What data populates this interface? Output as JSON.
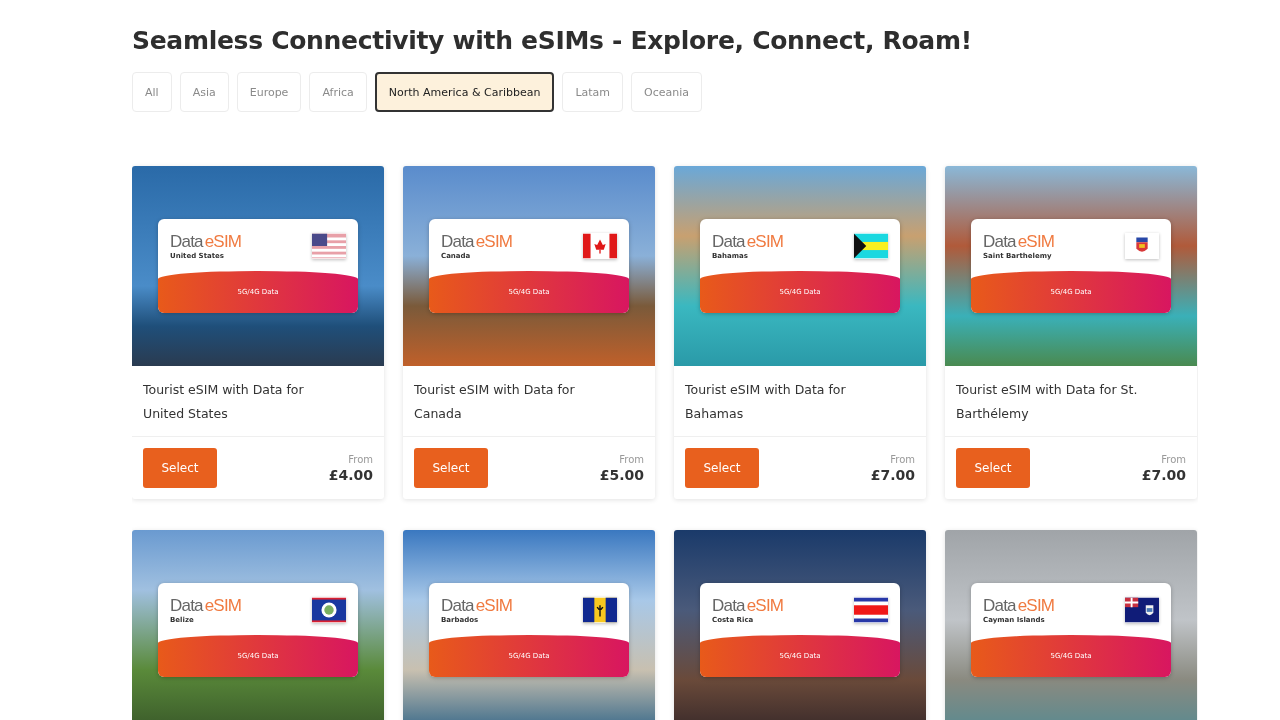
{
  "heading": "Seamless Connectivity with eSIMs - Explore, Connect, Roam!",
  "tabs": [
    {
      "label": "All",
      "selected": false
    },
    {
      "label": "Asia",
      "selected": false
    },
    {
      "label": "Europe",
      "selected": false
    },
    {
      "label": "Africa",
      "selected": false
    },
    {
      "label": "North America & Caribbean",
      "selected": true
    },
    {
      "label": "Latam",
      "selected": false
    },
    {
      "label": "Oceania",
      "selected": false
    }
  ],
  "cards": [
    {
      "brand": "Data",
      "brand_accent": "eSIM",
      "country": "United States",
      "kind": "us",
      "data_label": "5G/4G Data",
      "title": "Tourist eSIM with Data for United States",
      "button": "Select",
      "price_prefix": "From",
      "price": "£4.00"
    },
    {
      "brand": "Data",
      "brand_accent": "eSIM",
      "country": "Canada",
      "kind": "ca",
      "data_label": "5G/4G Data",
      "title": "Tourist eSIM with Data for Canada",
      "button": "Select",
      "price_prefix": "From",
      "price": "£5.00"
    },
    {
      "brand": "Data",
      "brand_accent": "eSIM",
      "country": "Bahamas",
      "kind": "bs",
      "data_label": "5G/4G Data",
      "title": "Tourist eSIM with Data for Bahamas",
      "button": "Select",
      "price_prefix": "From",
      "price": "£7.00"
    },
    {
      "brand": "Data",
      "brand_accent": "eSIM",
      "country": "Saint Barthelemy",
      "kind": "bl",
      "data_label": "5G/4G Data",
      "title": "Tourist eSIM with Data for St. Barthélemy",
      "button": "Select",
      "price_prefix": "From",
      "price": "£7.00"
    },
    {
      "brand": "Data",
      "brand_accent": "eSIM",
      "country": "Belize",
      "kind": "bz",
      "data_label": "5G/4G Data"
    },
    {
      "brand": "Data",
      "brand_accent": "eSIM",
      "country": "Barbados",
      "kind": "bb",
      "data_label": "5G/4G Data"
    },
    {
      "brand": "Data",
      "brand_accent": "eSIM",
      "country": "Costa Rica",
      "kind": "cr",
      "data_label": "5G/4G Data"
    },
    {
      "brand": "Data",
      "brand_accent": "eSIM",
      "country": "Cayman Islands",
      "kind": "ky",
      "data_label": "5G/4G Data"
    }
  ]
}
